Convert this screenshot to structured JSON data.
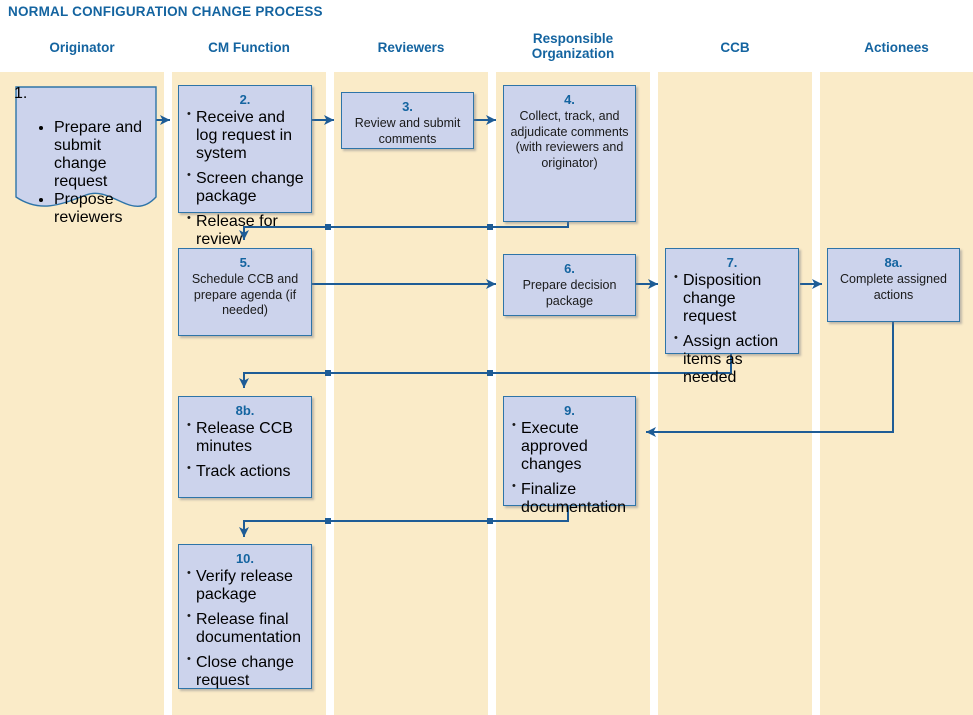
{
  "title": "NORMAL CONFIGURATION CHANGE PROCESS",
  "colors": {
    "accent_blue": "#1464A0",
    "lane_background": "#FAEBC8",
    "node_fill": "#CCD3EC",
    "node_border": "#2E74A8",
    "connector": "#1E5C96",
    "page_background": "#FFFFFF"
  },
  "lanes": [
    {
      "label": "Originator"
    },
    {
      "label": "CM Function"
    },
    {
      "label": "Reviewers"
    },
    {
      "label": "Responsible\nOrganization",
      "line1": "Responsible",
      "line2": "Organization"
    },
    {
      "label": "CCB"
    },
    {
      "label": "Actionees"
    }
  ],
  "nodes": [
    {
      "id": "1",
      "number": "1.",
      "lane": "Originator",
      "shape": "document",
      "bullets": [
        "Prepare and submit change request",
        "Propose reviewers"
      ]
    },
    {
      "id": "2",
      "number": "2.",
      "lane": "CM Function",
      "shape": "rect",
      "bullets": [
        "Receive and log request in system",
        "Screen change package",
        "Release for review"
      ]
    },
    {
      "id": "3",
      "number": "3.",
      "lane": "Reviewers",
      "shape": "rect",
      "text": "Review and submit comments"
    },
    {
      "id": "4",
      "number": "4.",
      "lane": "Responsible Organization",
      "shape": "rect",
      "text": "Collect, track, and adjudicate comments (with reviewers and originator)"
    },
    {
      "id": "5",
      "number": "5.",
      "lane": "CM Function",
      "shape": "rect",
      "text": "Schedule CCB and prepare agenda (if needed)"
    },
    {
      "id": "6",
      "number": "6.",
      "lane": "Responsible Organization",
      "shape": "rect",
      "text": "Prepare decision package"
    },
    {
      "id": "7",
      "number": "7.",
      "lane": "CCB",
      "shape": "rect",
      "bullets": [
        "Disposition change request",
        "Assign action items as needed"
      ]
    },
    {
      "id": "8a",
      "number": "8a.",
      "lane": "Actionees",
      "shape": "rect",
      "text": "Complete assigned actions"
    },
    {
      "id": "8b",
      "number": "8b.",
      "lane": "CM Function",
      "shape": "rect",
      "bullets": [
        "Release CCB minutes",
        "Track actions"
      ]
    },
    {
      "id": "9",
      "number": "9.",
      "lane": "Responsible Organization",
      "shape": "rect",
      "bullets": [
        "Execute approved changes",
        "Finalize documentation"
      ]
    },
    {
      "id": "10",
      "number": "10.",
      "lane": "CM Function",
      "shape": "rect",
      "bullets": [
        "Verify release package",
        "Release final documentation",
        "Close change request"
      ]
    }
  ],
  "connections": [
    {
      "from": "1",
      "to": "2",
      "direction": "right"
    },
    {
      "from": "2",
      "to": "3",
      "direction": "right"
    },
    {
      "from": "3",
      "to": "4",
      "direction": "right"
    },
    {
      "from": "4",
      "to": "5",
      "direction": "down-left"
    },
    {
      "from": "5",
      "to": "6",
      "direction": "right"
    },
    {
      "from": "6",
      "to": "7",
      "direction": "right"
    },
    {
      "from": "7",
      "to": "8a",
      "direction": "right"
    },
    {
      "from": "7",
      "to": "8b",
      "direction": "down-left"
    },
    {
      "from": "8a",
      "to": "9",
      "direction": "down-left"
    },
    {
      "from": "9",
      "to": "10",
      "direction": "down-left"
    }
  ]
}
